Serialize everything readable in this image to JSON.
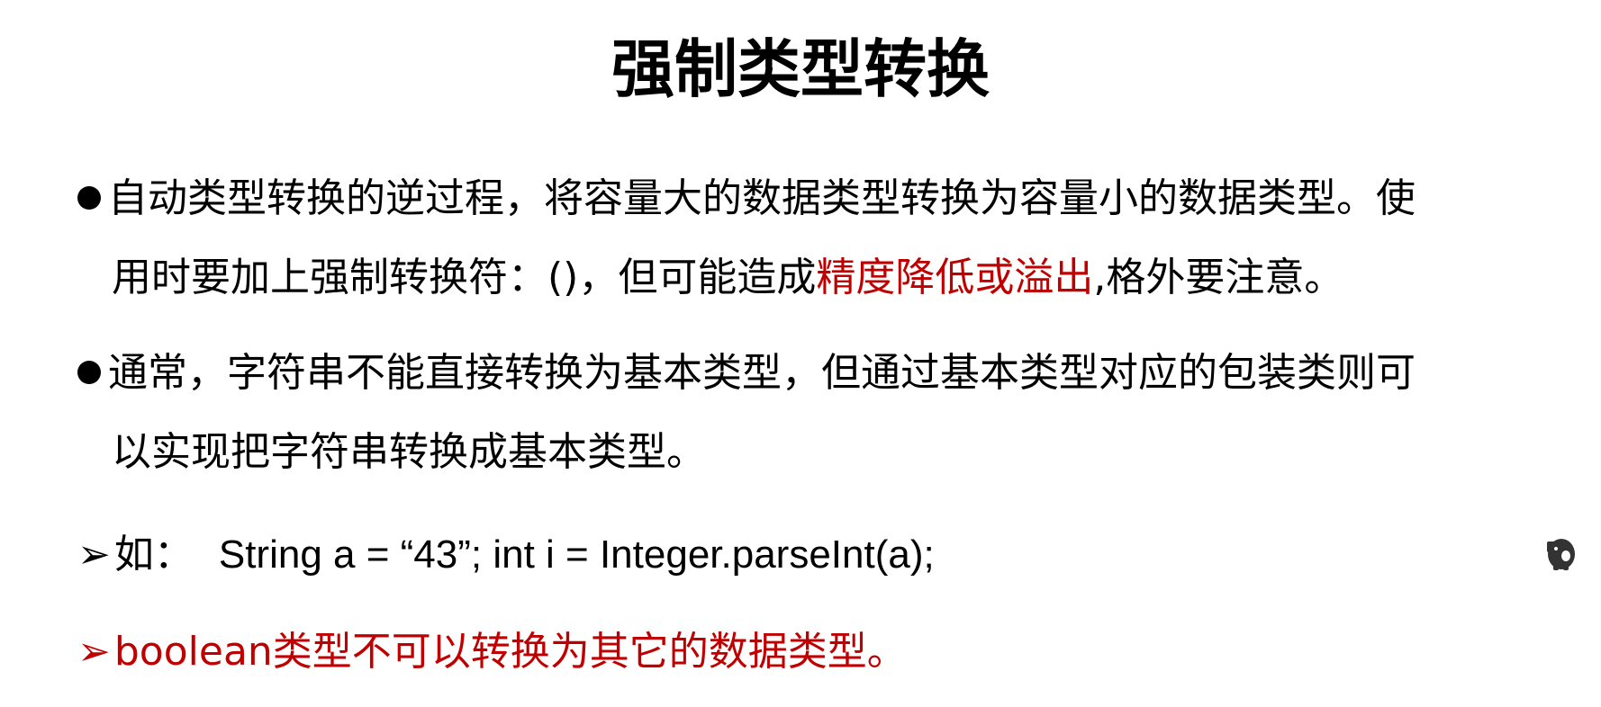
{
  "title": "强制类型转换",
  "bullets": [
    {
      "line1": "自动类型转换的逆过程，将容量大的数据类型转换为容量小的数据类型。使",
      "line2_pre": "用时要加上强制转换符：()，但可能造成",
      "line2_red": "精度降低或溢出",
      "line2_post": ",格外要注意。"
    },
    {
      "line1": "通常，字符串不能直接转换为基本类型，但通过基本类型对应的包装类则可",
      "line2": "以实现把字符串转换成基本类型。"
    }
  ],
  "example": {
    "arrow": "➢",
    "prefix": "如：",
    "code": "String a = “43”; int i = Integer.parseInt(a);"
  },
  "note": {
    "arrow": "➢",
    "text": "boolean类型不可以转换为其它的数据类型。"
  },
  "colors": {
    "accent_red": "#c00000",
    "text": "#000000"
  },
  "icons": {
    "corner_icon": "elephant-icon"
  }
}
